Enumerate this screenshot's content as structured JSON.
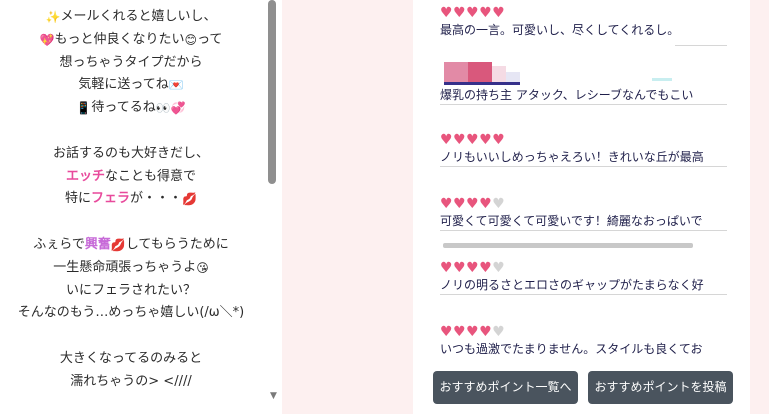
{
  "message": {
    "lines": [
      {
        "parts": [
          {
            "t": "✨",
            "k": "emo"
          },
          {
            "t": "メールくれると嬉しいし、"
          }
        ]
      },
      {
        "parts": [
          {
            "t": "💖",
            "k": "emo"
          },
          {
            "t": "もっと仲良くなりたい"
          },
          {
            "t": "😊",
            "k": "emo"
          },
          {
            "t": "って"
          }
        ]
      },
      {
        "parts": [
          {
            "t": "想っちゃうタイプだから"
          }
        ]
      },
      {
        "parts": [
          {
            "t": "気軽に送ってね"
          },
          {
            "t": "💌",
            "k": "emo"
          }
        ]
      },
      {
        "parts": [
          {
            "t": "📱",
            "k": "emo"
          },
          {
            "t": "待ってるね"
          },
          {
            "t": "👀",
            "k": "emo"
          },
          {
            "t": "💞",
            "k": "emo"
          }
        ]
      },
      {
        "blank": true
      },
      {
        "parts": [
          {
            "t": "お話するのも大好きだし、"
          }
        ]
      },
      {
        "parts": [
          {
            "t": "エッチ",
            "k": "pink"
          },
          {
            "t": "なことも得意で"
          }
        ]
      },
      {
        "parts": [
          {
            "t": "特に"
          },
          {
            "t": "フェラ",
            "k": "pink"
          },
          {
            "t": "が・・・"
          },
          {
            "t": "💋",
            "k": "emo"
          }
        ]
      },
      {
        "blank": true
      },
      {
        "parts": [
          {
            "t": "ふぇらで"
          },
          {
            "t": "興奮",
            "k": "purple"
          },
          {
            "t": "💋",
            "k": "emo"
          },
          {
            "t": "してもらうために"
          }
        ]
      },
      {
        "parts": [
          {
            "t": "一生懸命頑張っちゃうよ"
          },
          {
            "t": "😘",
            "k": "emo"
          }
        ]
      },
      {
        "parts": [
          {
            "t": "いにフェラされたい？"
          }
        ]
      },
      {
        "parts": [
          {
            "t": "そんなのもう…めっちゃ嬉しい(/ω＼*)"
          }
        ]
      },
      {
        "blank": true
      },
      {
        "parts": [
          {
            "t": "大きくなってるのみると"
          }
        ]
      },
      {
        "parts": [
          {
            "t": "濡れちゃうの> <////"
          }
        ]
      }
    ]
  },
  "reviews": [
    {
      "rating": 5,
      "comment": "最高の一言。可愛いし、尽くしてくれるし。"
    },
    {
      "rating": null,
      "comment": "爆乳の持ち主 アタック、レシーブなんでもこい"
    },
    {
      "rating": 5,
      "comment": "ノリもいいしめっちゃえろい！きれいな丘が最高"
    },
    {
      "rating": 4,
      "comment": "可愛くて可愛くて可愛いです！綺麗なおっぱいで"
    },
    {
      "rating": 4,
      "comment": "ノリの明るさとエロさのギャップがたまらなく好"
    },
    {
      "rating": 4,
      "comment": "いつも過激でたまりません。スタイルも良くてお"
    }
  ],
  "rating_max": 5,
  "buttons": {
    "recommend_list": "おすすめポイント一覧へ",
    "recommend_post": "おすすめポイントを投稿"
  },
  "colors": {
    "star_on": "#e8557d",
    "star_off": "#d4d4d4",
    "highlight_pink": "#e84a9c",
    "highlight_purple": "#c76ad8",
    "button_bg": "#4a545e",
    "page_band": "#fdf0f0"
  },
  "icons": {
    "scroll_down": "▼",
    "star": "♥"
  }
}
